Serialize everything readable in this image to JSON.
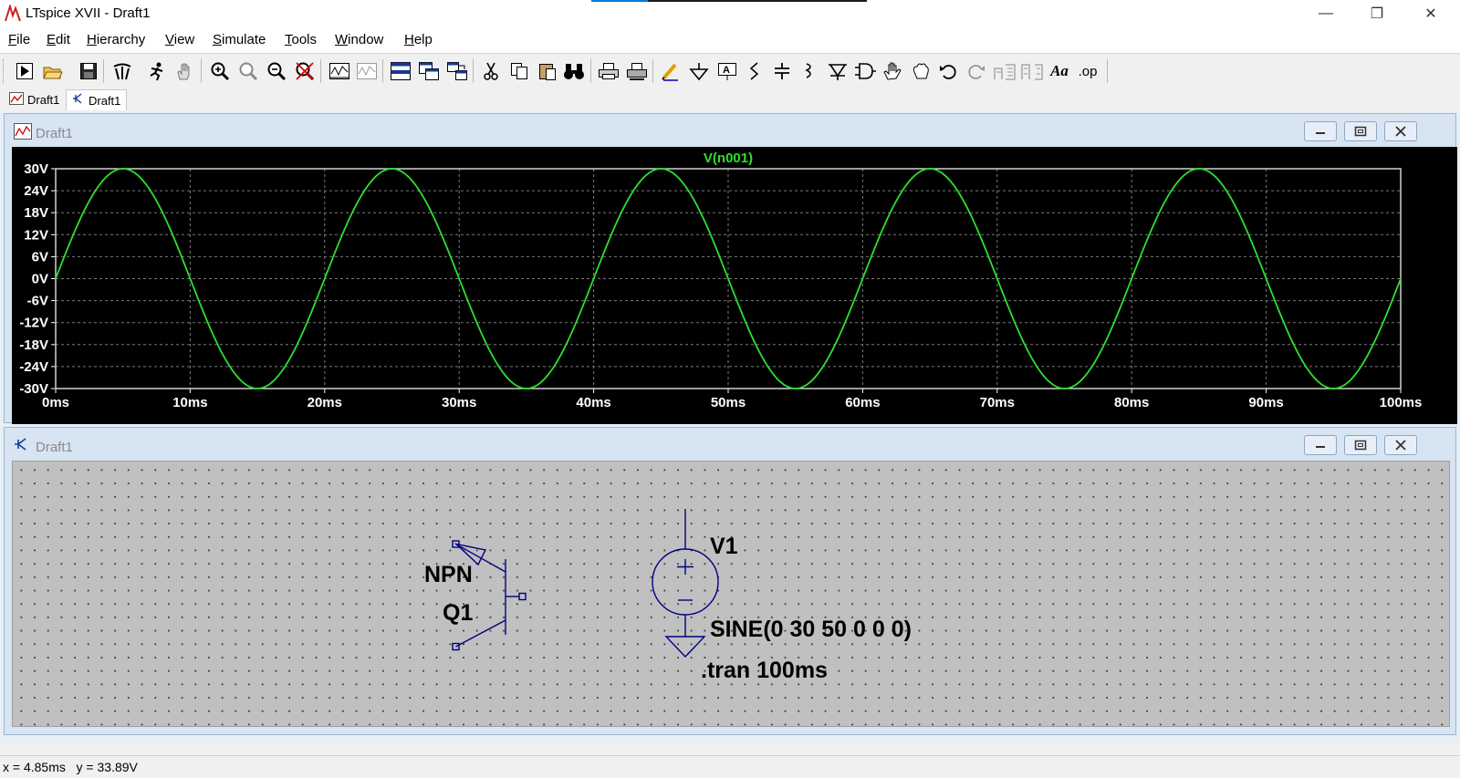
{
  "window": {
    "title": "LTspice XVII - Draft1",
    "controls": {
      "minimize": "—",
      "restore": "❐",
      "close": "✕"
    }
  },
  "menu": [
    "File",
    "Edit",
    "Hierarchy",
    "View",
    "Simulate",
    "Tools",
    "Window",
    "Help"
  ],
  "toolbar": {
    "icons": [
      "run-icon",
      "open-icon",
      "save-icon",
      "control-panel-icon",
      "halt-icon",
      "pan-hand-icon",
      "zoom-in-icon",
      "zoom-area-icon",
      "zoom-out-icon",
      "zoom-cancel-icon",
      "autorange-icon",
      "delete-trace-icon",
      "tile-horizontal-icon",
      "tile-vertical-icon",
      "cascade-icon",
      "cut-icon",
      "copy-icon",
      "paste-icon",
      "find-icon",
      "print-icon",
      "print-setup-icon",
      "wire-icon",
      "ground-icon",
      "label-net-icon",
      "resistor-icon",
      "capacitor-icon",
      "inductor-icon",
      "diode-icon",
      "component-icon",
      "move-icon",
      "drag-icon",
      "undo-icon",
      "redo-icon",
      "rotate-icon",
      "mirror-icon",
      "text-icon",
      "spice-directive-icon"
    ],
    "text_buttons": {
      "text": "Aa",
      "directive": ".op"
    }
  },
  "tabs": [
    {
      "label": "Draft1",
      "icon": "waveform-icon"
    },
    {
      "label": "Draft1",
      "icon": "schematic-icon"
    }
  ],
  "waveform_window": {
    "title": "Draft1"
  },
  "schematic_window": {
    "title": "Draft1"
  },
  "chart_data": {
    "type": "line",
    "title": "V(n001)",
    "xlabel": "",
    "ylabel": "",
    "x_ticks": [
      "0ms",
      "10ms",
      "20ms",
      "30ms",
      "40ms",
      "50ms",
      "60ms",
      "70ms",
      "80ms",
      "90ms",
      "100ms"
    ],
    "y_ticks": [
      "30V",
      "24V",
      "18V",
      "12V",
      "6V",
      "0V",
      "-6V",
      "-12V",
      "-18V",
      "-24V",
      "-30V"
    ],
    "xlim": [
      0,
      100
    ],
    "ylim": [
      -30,
      30
    ],
    "grid": true,
    "series": [
      {
        "name": "V(n001)",
        "function": "30*sin(2*pi*50*t)",
        "amplitude": 30,
        "frequency_hz": 50,
        "offset": 0
      }
    ],
    "colors": {
      "trace": "#2de02d",
      "background": "#000000",
      "grid": "#7a7a7a",
      "axis_text": "#ffffff"
    }
  },
  "schematic": {
    "transistor": {
      "model": "NPN",
      "name": "Q1"
    },
    "source": {
      "name": "V1",
      "value": "SINE(0 30 50 0 0 0)"
    },
    "directive": ".tran 100ms",
    "colors": {
      "wire": "#000080"
    }
  },
  "status": {
    "x": "x = 4.85ms",
    "y": "y = 33.89V"
  }
}
